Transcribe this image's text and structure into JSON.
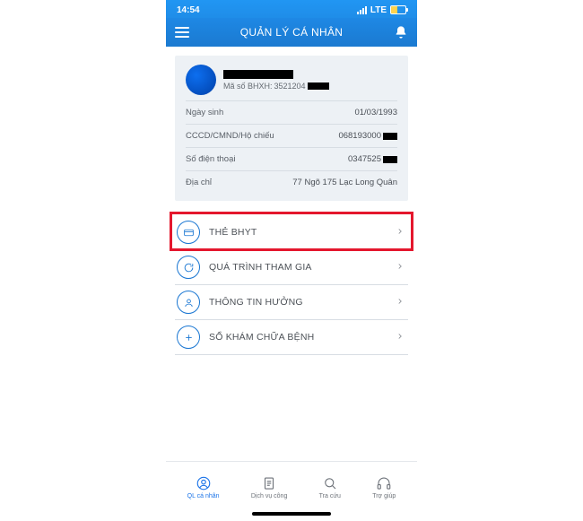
{
  "status": {
    "time": "14:54",
    "network": "LTE"
  },
  "header": {
    "title": "QUẢN LÝ CÁ NHÂN"
  },
  "profile": {
    "bhxh_label": "Mã số BHXH:",
    "bhxh_number": "3521204",
    "fields": {
      "dob_label": "Ngày sinh",
      "dob_value": "01/03/1993",
      "id_label": "CCCD/CMND/Hộ chiếu",
      "id_value": "068193000",
      "phone_label": "Số điện thoại",
      "phone_value": "0347525",
      "addr_label": "Địa chỉ",
      "addr_value": "77 Ngõ 175 Lạc Long Quân"
    }
  },
  "menu": {
    "bhyt": "THẺ BHYT",
    "participation": "QUÁ TRÌNH THAM GIA",
    "benefits": "THÔNG TIN HƯỞNG",
    "health_book": "SỔ KHÁM CHỮA BỆNH"
  },
  "tabs": {
    "personal": "QL cá nhân",
    "public_service": "Dịch vụ công",
    "lookup": "Tra cứu",
    "support": "Trợ giúp"
  }
}
